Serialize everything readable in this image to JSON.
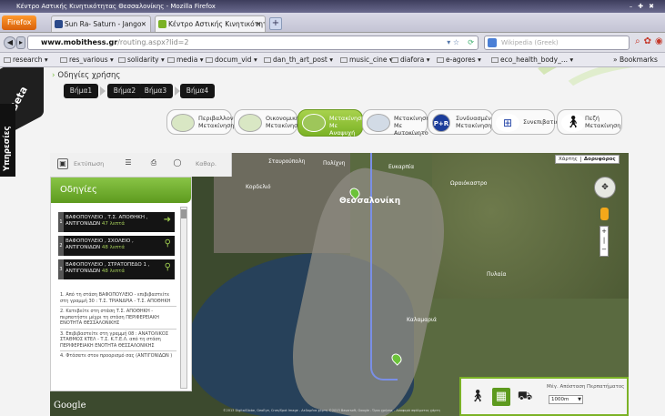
{
  "browser": {
    "window_title": "Κέντρο Αστικής Κινητικότητας Θεσσαλονίκης - Mozilla Firefox",
    "firefox_button": "Firefox",
    "tabs": [
      {
        "label": "Sun Ra- Saturn - Jango"
      },
      {
        "label": "Κέντρο Αστικής Κινητικότητα..."
      }
    ],
    "new_tab": "+",
    "url_domain": "www.mobithess.gr",
    "url_path": "/routing.aspx?lid=2",
    "search_placeholder": "Wikipedia (Greek)",
    "bookmarks": [
      "research",
      "res_various",
      "solidarity",
      "media",
      "docum_vid",
      "dan_th_art_post",
      "music_cine",
      "diafora",
      "e-agores",
      "eco_health_body_...",
      "Bookmarks"
    ]
  },
  "page": {
    "beta_label": "Beta",
    "services_label": "Υπηρεσίες",
    "guide_title": "Οδηγίες χρήσης",
    "steps": [
      "Βήμα1",
      "Βήμα2",
      "Βήμα3",
      "Βήμα4"
    ],
    "modes": [
      {
        "label": "Περιβαλλοντική Μετακίνηση"
      },
      {
        "label": "Οικονομική Μετακίνηση"
      },
      {
        "label": "Μετακίνηση Με Αναψυχή"
      },
      {
        "label": "Μετακίνηση Με Αυτοκίνητο"
      },
      {
        "label": "Συνδυασμένη Μετακίνηση"
      },
      {
        "label": "Συνεπιβατισμός"
      },
      {
        "label": "Πεζή Μετακίνηση"
      }
    ],
    "mode_p_icon": "P+R"
  },
  "map": {
    "toolbar": {
      "print_label": "Εκτύπωση",
      "clear_label": "Καθαρ."
    },
    "panel_title": "Οδηγίες",
    "routes": [
      {
        "num": "1",
        "text": "ΒΑΦΟΠΟΥΛΕΙΟ , Τ.Σ. ΑΠΟΘΗΚΗ , ΑΝΤΙΓΟΝΙΔΩΝ",
        "time": "47 λεπτά"
      },
      {
        "num": "2",
        "text": "ΒΑΦΟΠΟΥΛΕΙΟ , ΣΧΟΛΕΙΟ , ΑΝΤΙΓΟΝΙΔΩΝ",
        "time": "48 λεπτά"
      },
      {
        "num": "3",
        "text": "ΒΑΦΟΠΟΥΛΕΙΟ , ΣΤΡΑΤΟΠΕΔΟ 1 , ΑΝΤΙΓΟΝΙΔΩΝ",
        "time": "48 λεπτά"
      }
    ],
    "instructions": [
      "1. Από τη στάση ΒΑΦΟΠΟΥΛΕΙΟ - επιβιβαστείτε στη γραμμή 30 : Τ.Σ. ΤΡΙΑΝΔΡΙΑ - Τ.Σ. ΑΠΟΘΗΚΗ",
      "2. Κατεβείτε στη στάση Τ.Σ. ΑΠΟΘΗΚΗ - περπατήστε μέχρι τη στάση ΠΕΡΙΦΕΡΕΙΑΚΗ ΕΝΟΤΗΤΑ ΘΕΣΣΑΛΟΝΙΚΗΣ",
      "3. Επιβιβαστείτε στη γραμμή 08 : ΑΝΑΤΟΛΙΚΟΣ ΣΤΑΘΜΟΣ ΚΤΕΛ - Τ.Σ. Κ.Τ.Ε.Λ. από τη στάση ΠΕΡΙΦΕΡΕΙΑΚΗ ΕΝΟΤΗΤΑ ΘΕΣΣΑΛΟΝΙΚΗΣ",
      "4. Φτάσατε στον προορισμό σας (ΑΝΤΙΓΟΝΙΔΩΝ )"
    ],
    "map_type": {
      "map": "Χάρτης",
      "satellite": "Δορυφόρος"
    },
    "city_label": "Θεσσαλονίκη",
    "labels": [
      "Σταυρούπολη",
      "Ευκαρπία",
      "Πολίχνη",
      "Κορδελιό",
      "Ωραιόκαστρο",
      "Πυλαία",
      "Καλαμαριά"
    ],
    "google": "Google",
    "copyright": "©2013 DigitalGlobe, GeoEye, Cnes/Spot Image - Δεδομένα χάρτη ©2013 Basarsoft, Google - Όροι χρήσης - Αναφορά σφάλματος χάρτη",
    "bottom": {
      "label": "Μέγ. Απόσταση Περπατήματος",
      "value": "1000m"
    }
  }
}
